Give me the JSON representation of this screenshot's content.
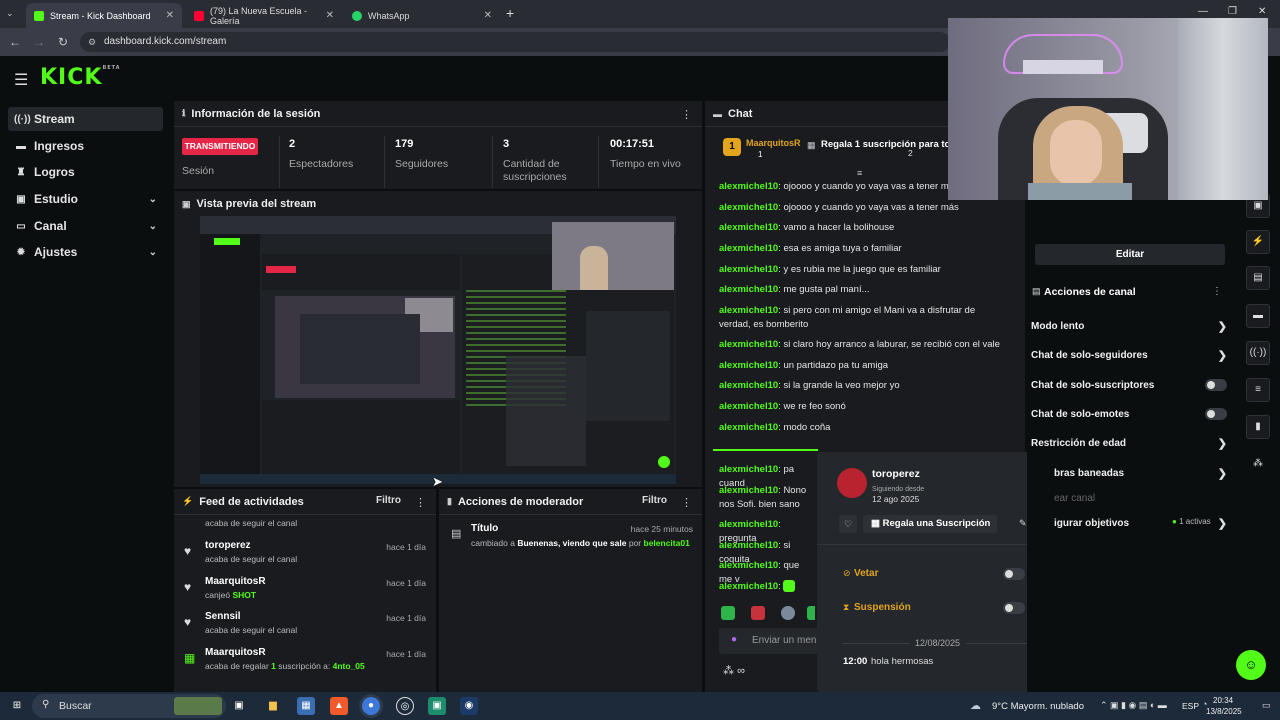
{
  "browser": {
    "tabs": [
      {
        "label": "Stream - Kick Dashboard",
        "active": true,
        "favicon": "kick-icon"
      },
      {
        "label": "(79) La Nueva Escuela - Galería",
        "active": false,
        "favicon": "youtube-icon"
      },
      {
        "label": "WhatsApp",
        "active": false,
        "favicon": "whatsapp-icon"
      }
    ],
    "new_tab": "+",
    "url": "dashboard.kick.com/stream"
  },
  "app": {
    "logo": "KICK",
    "logo_badge": "BETA"
  },
  "sidebar": {
    "items": [
      {
        "label": "Stream",
        "icon": "broadcast-icon",
        "active": true,
        "has_chevron": false
      },
      {
        "label": "Ingresos",
        "icon": "money-icon",
        "has_chevron": false
      },
      {
        "label": "Logros",
        "icon": "trophy-icon",
        "has_chevron": false
      },
      {
        "label": "Estudio",
        "icon": "studio-icon",
        "has_chevron": true
      },
      {
        "label": "Canal",
        "icon": "channel-icon",
        "has_chevron": true
      },
      {
        "label": "Ajustes",
        "icon": "gear-icon",
        "has_chevron": true
      }
    ]
  },
  "session": {
    "title": "Información de la sesión",
    "live_badge": "TRANSMITIENDO",
    "session_label": "Sesión",
    "stats": [
      {
        "value": "2",
        "label": "Espectadores"
      },
      {
        "value": "179",
        "label": "Seguidores"
      },
      {
        "value": "3",
        "label": "Cantidad de suscripciones"
      },
      {
        "value": "00:17:51",
        "label": "Tiempo en vivo"
      }
    ]
  },
  "preview": {
    "title": "Vista previa del stream"
  },
  "activity_feed": {
    "title": "Feed de actividades",
    "filter": "Filtro",
    "items": [
      {
        "name": "",
        "detail": "acaba de seguir el canal",
        "time": "",
        "icon": ""
      },
      {
        "name": "toroperez",
        "detail": "acaba de seguir el canal",
        "time": "hace 1 día",
        "icon": "heart-icon"
      },
      {
        "name": "MaarquitosR",
        "detail_prefix": "canjeó",
        "detail_highlight": "SHOT",
        "time": "hace 1 día",
        "icon": "heart-icon"
      },
      {
        "name": "Sennsil",
        "detail": "acaba de seguir el canal",
        "time": "hace 1 día",
        "icon": "heart-icon"
      },
      {
        "name": "MaarquitosR",
        "detail_prefix": "acaba de regalar",
        "detail_count": "1",
        "detail_mid": "suscripción a:",
        "detail_highlight": "4nto_05",
        "time": "hace 1 día",
        "icon": "gift-icon"
      }
    ]
  },
  "mod_actions": {
    "title": "Acciones de moderador",
    "filter": "Filtro",
    "item": {
      "label": "Título",
      "time": "hace 25 minutos",
      "prefix": "cambiado a",
      "new_title": "Buenenas, viendo que sale",
      "by": "por",
      "user": "belencita01"
    }
  },
  "chat": {
    "title": "Chat",
    "pinned_user": "MaarquitosR",
    "pinned_badge": "1",
    "pinned_text": "Regala 1 suscripción para toma",
    "pinned_count": "2",
    "messages": [
      {
        "user": "alexmichel10",
        "text": "ojoooo y cuando yo vaya vas a tener mas"
      },
      {
        "user": "alexmichel10",
        "text": "ojoooo y cuando yo vaya vas a tener más"
      },
      {
        "user": "alexmichel10",
        "text": "vamo a hacer la bolihouse"
      },
      {
        "user": "alexmichel10",
        "text": "esa es amiga tuya o familiar"
      },
      {
        "user": "alexmichel10",
        "text": "y es rubia me la juego que es familiar"
      },
      {
        "user": "alexmichel10",
        "text": "me gusta pal maní..."
      },
      {
        "user": "alexmichel10",
        "text": "si pero con mi amigo el Mani va a disfrutar de verdad, es bomberito"
      },
      {
        "user": "alexmichel10",
        "text": "si claro hoy arranco a laburar, se recibió con el vale"
      },
      {
        "user": "alexmichel10",
        "text": "un partidazo pa tu amiga"
      },
      {
        "user": "alexmichel10",
        "text": "si la grande la veo mejor yo"
      },
      {
        "user": "alexmichel10",
        "text": "we re feo sonó"
      },
      {
        "user": "alexmichel10",
        "text": "modo coña"
      },
      {
        "user": "alexmichel10",
        "text": "pa cuand"
      },
      {
        "user": "alexmichel10",
        "text": "Nono nos Sofi. bien sano"
      },
      {
        "user": "alexmichel10",
        "text": "pregunta"
      },
      {
        "user": "alexmichel10",
        "text": "si coquita"
      },
      {
        "user": "alexmichel10",
        "text": "que me v"
      },
      {
        "user": "alexmichel10",
        "text": ""
      }
    ],
    "input_placeholder": "Enviar un men",
    "footer_icon": "∞"
  },
  "user_popup": {
    "username": "toroperez",
    "following_since_label": "Siguiendo desde",
    "following_since": "12 ago 2025",
    "gift_button": "Regala una Suscripción",
    "ban_label": "Vetar",
    "timeout_label": "Suspensión",
    "date": "12/08/2025",
    "msg_time": "12:00",
    "msg_text": "hola hermosas"
  },
  "channel_actions": {
    "edit_button": "Editar",
    "title": "Acciones de canal",
    "items": [
      {
        "label": "Modo lento",
        "control": "arrow"
      },
      {
        "label": "Chat de solo-seguidores",
        "control": "arrow"
      },
      {
        "label": "Chat de solo-suscriptores",
        "control": "toggle"
      },
      {
        "label": "Chat de solo-emotes",
        "control": "toggle"
      },
      {
        "label": "Restricción de edad",
        "control": "arrow"
      },
      {
        "label": "bras baneadas",
        "control": "arrow"
      },
      {
        "label": "ear canal",
        "control": "none"
      },
      {
        "label": "igurar objetivos",
        "control": "arrow",
        "badge": "1 activas"
      }
    ]
  },
  "taskbar": {
    "search": "Buscar",
    "weather": "9°C  Mayorm. nublado",
    "lang": "ESP",
    "time": "20:34",
    "date": "13/8/2025"
  },
  "colors": {
    "accent": "#53fc18",
    "live": "#e62646",
    "panel": "#191b1f",
    "bg": "#0b0e0f"
  }
}
